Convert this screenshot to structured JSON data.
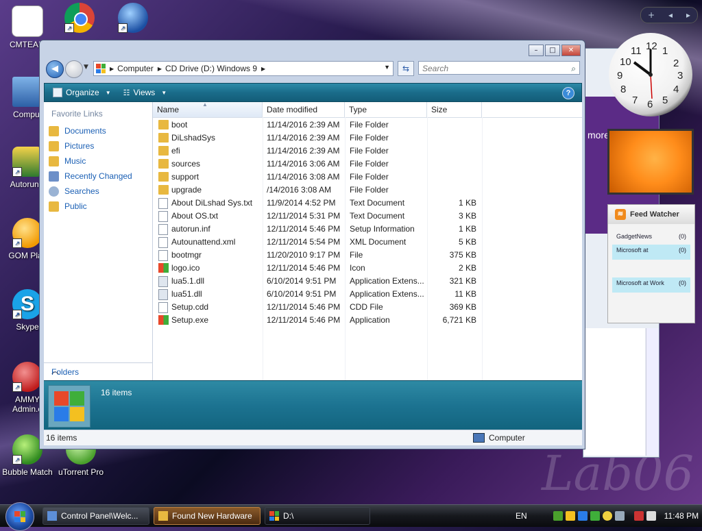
{
  "desktop": {
    "icons": [
      {
        "label": "CMTEAM"
      },
      {
        "label": ""
      },
      {
        "label": ""
      },
      {
        "label": "Comput"
      },
      {
        "label": "AutorunR"
      },
      {
        "label": "GOM Play"
      },
      {
        "label": "Skype"
      },
      {
        "label": "AMMY Admin.e"
      },
      {
        "label": "Bubble Match"
      },
      {
        "label": "uTorrent Pro"
      }
    ],
    "watermark": "Lab06"
  },
  "window": {
    "nav": {
      "address_crumbs": [
        "Computer",
        "CD Drive (D:) Windows 9"
      ],
      "search_placeholder": "Search"
    },
    "toolbar": {
      "organize_label": "Organize",
      "views_label": "Views",
      "help_label": "?"
    },
    "sidebar": {
      "favorite_links_title": "Favorite Links",
      "items": [
        {
          "label": "Documents",
          "icon": "documents-folder-icon"
        },
        {
          "label": "Pictures",
          "icon": "pictures-folder-icon"
        },
        {
          "label": "Music",
          "icon": "music-folder-icon"
        },
        {
          "label": "Recently Changed",
          "icon": "recently-changed-icon"
        },
        {
          "label": "Searches",
          "icon": "search-folder-icon"
        },
        {
          "label": "Public",
          "icon": "public-folder-icon"
        }
      ],
      "folders_label": "Folders"
    },
    "columns": {
      "name": "Name",
      "date": "Date modified",
      "type": "Type",
      "size": "Size"
    },
    "files": [
      {
        "name": "boot",
        "date": "11/14/2016 2:39 AM",
        "type": "File Folder",
        "size": "",
        "icon": "folder"
      },
      {
        "name": "DiLshadSys",
        "date": "11/14/2016 2:39 AM",
        "type": "File Folder",
        "size": "",
        "icon": "folder"
      },
      {
        "name": "efi",
        "date": "11/14/2016 2:39 AM",
        "type": "File Folder",
        "size": "",
        "icon": "folder"
      },
      {
        "name": "sources",
        "date": "11/14/2016 3:06 AM",
        "type": "File Folder",
        "size": "",
        "icon": "folder"
      },
      {
        "name": "support",
        "date": "11/14/2016 3:08 AM",
        "type": "File Folder",
        "size": "",
        "icon": "folder"
      },
      {
        "name": "upgrade",
        "date": "/14/2016 3:08 AM",
        "type": "File Folder",
        "size": "",
        "icon": "folder"
      },
      {
        "name": "About DiLshad Sys.txt",
        "date": "11/9/2014 4:52 PM",
        "type": "Text Document",
        "size": "1 KB",
        "icon": "text"
      },
      {
        "name": "About OS.txt",
        "date": "12/11/2014 5:31 PM",
        "type": "Text Document",
        "size": "3 KB",
        "icon": "text"
      },
      {
        "name": "autorun.inf",
        "date": "12/11/2014 5:46 PM",
        "type": "Setup Information",
        "size": "1 KB",
        "icon": "setup"
      },
      {
        "name": "Autounattend.xml",
        "date": "12/11/2014 5:54 PM",
        "type": "XML Document",
        "size": "5 KB",
        "icon": "xml"
      },
      {
        "name": "bootmgr",
        "date": "11/20/2010 9:17 PM",
        "type": "File",
        "size": "375 KB",
        "icon": "file"
      },
      {
        "name": "logo.ico",
        "date": "12/11/2014 5:46 PM",
        "type": "Icon",
        "size": "2 KB",
        "icon": "logo"
      },
      {
        "name": "lua5.1.dll",
        "date": "6/10/2014 9:51 PM",
        "type": "Application Extens...",
        "size": "321 KB",
        "icon": "dll"
      },
      {
        "name": "lua51.dll",
        "date": "6/10/2014 9:51 PM",
        "type": "Application Extens...",
        "size": "11 KB",
        "icon": "dll"
      },
      {
        "name": "Setup.cdd",
        "date": "12/11/2014 5:46 PM",
        "type": "CDD File",
        "size": "369 KB",
        "icon": "file"
      },
      {
        "name": "Setup.exe",
        "date": "12/11/2014 5:46 PM",
        "type": "Application",
        "size": "6,721 KB",
        "icon": "logo"
      }
    ],
    "details_count": "16 items",
    "status_left": "16 items",
    "status_right": "Computer"
  },
  "background_window": {
    "text": "more"
  },
  "gadgets": {
    "clock_numbers": [
      "12",
      "1",
      "2",
      "3",
      "4",
      "5",
      "6",
      "7",
      "8",
      "9",
      "10",
      "11"
    ],
    "feed": {
      "title": "Feed Watcher",
      "items": [
        {
          "name": "GadgetNews",
          "count": "(0)"
        },
        {
          "name": "Microsoft at",
          "count": "(0)"
        },
        {
          "name": "Microsoft at Work",
          "count": "(0)"
        }
      ]
    }
  },
  "taskbar": {
    "tasks": [
      {
        "label": "Control Panel\\Welc..."
      },
      {
        "label": "Found New Hardware"
      },
      {
        "label": "D:\\"
      }
    ],
    "language": "EN",
    "time": "11:48 PM"
  },
  "colors": {
    "accent": "#1a5fb4",
    "teal_bar": "#1a6c8a",
    "folder": "#e8b840"
  }
}
